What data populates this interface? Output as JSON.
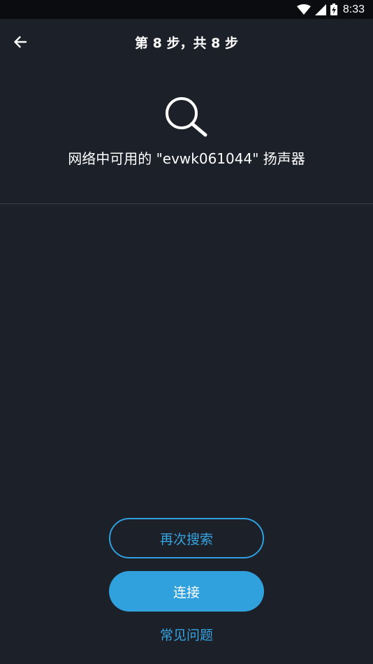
{
  "status_bar": {
    "time": "8:33",
    "icons": [
      "wifi-icon",
      "signal-icon",
      "battery-charging-icon"
    ]
  },
  "header": {
    "back_icon": "back-arrow-icon",
    "title": "第 8 步，共 8 步"
  },
  "main": {
    "illustration_icon": "search-icon",
    "message": "网络中可用的 \"evwk061044\" 扬声器"
  },
  "actions": {
    "search_again_label": "再次搜索",
    "connect_label": "连接",
    "faq_label": "常见问题"
  },
  "colors": {
    "background": "#1c2029",
    "status_bar": "#0b0c0f",
    "accent": "#31a1dd",
    "divider": "#3a3f4a"
  }
}
